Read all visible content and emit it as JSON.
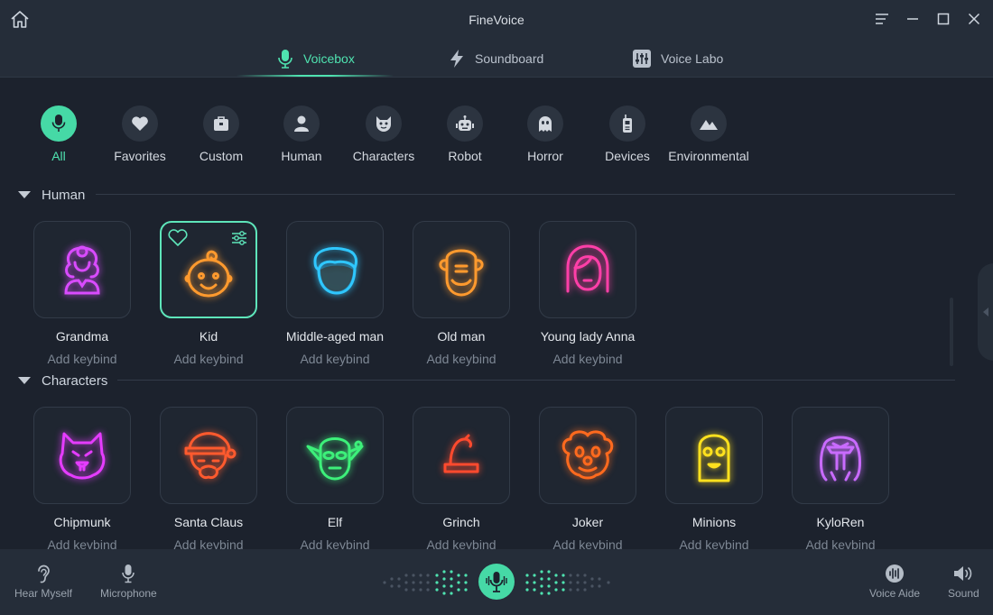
{
  "app": {
    "title": "FineVoice"
  },
  "tabs": [
    {
      "label": "Voicebox",
      "icon": "microphone-icon",
      "active": true
    },
    {
      "label": "Soundboard",
      "icon": "lightning-icon",
      "active": false
    },
    {
      "label": "Voice Labo",
      "icon": "sliders-icon",
      "active": false
    }
  ],
  "categories": [
    {
      "label": "All",
      "icon": "microphone-icon",
      "active": true
    },
    {
      "label": "Favorites",
      "icon": "heart-icon"
    },
    {
      "label": "Custom",
      "icon": "toolbox-icon"
    },
    {
      "label": "Human",
      "icon": "person-icon"
    },
    {
      "label": "Characters",
      "icon": "cat-face-icon"
    },
    {
      "label": "Robot",
      "icon": "robot-icon"
    },
    {
      "label": "Horror",
      "icon": "ghost-icon"
    },
    {
      "label": "Devices",
      "icon": "walkie-talkie-icon"
    },
    {
      "label": "Environmental",
      "icon": "mountain-icon"
    }
  ],
  "sections": [
    {
      "title": "Human",
      "voices": [
        {
          "name": "Grandma",
          "keybind": "Add keybind",
          "icon": "grandma-icon",
          "color": "#d94bff"
        },
        {
          "name": "Kid",
          "keybind": "Add keybind",
          "icon": "kid-icon",
          "color": "#ff9a2e",
          "selected": true
        },
        {
          "name": "Middle-aged man",
          "keybind": "Add keybind",
          "icon": "middle-aged-man-icon",
          "color": "#2fc7ff"
        },
        {
          "name": "Old man",
          "keybind": "Add keybind",
          "icon": "old-man-icon",
          "color": "#ff9a2e"
        },
        {
          "name": "Young lady Anna",
          "keybind": "Add keybind",
          "icon": "young-lady-icon",
          "color": "#ff3fa8"
        }
      ]
    },
    {
      "title": "Characters",
      "voices": [
        {
          "name": "Chipmunk",
          "keybind": "Add keybind",
          "icon": "chipmunk-icon",
          "color": "#e53cff"
        },
        {
          "name": "Santa Claus",
          "keybind": "Add keybind",
          "icon": "santa-claus-icon",
          "color": "#ff5a2e"
        },
        {
          "name": "Elf",
          "keybind": "Add keybind",
          "icon": "elf-icon",
          "color": "#3df07a"
        },
        {
          "name": "Grinch",
          "keybind": "Add keybind",
          "icon": "grinch-hat-icon",
          "color": "#ff4a2e"
        },
        {
          "name": "Joker",
          "keybind": "Add keybind",
          "icon": "joker-icon",
          "color": "#ff6a1e"
        },
        {
          "name": "Minions",
          "keybind": "Add keybind",
          "icon": "minion-icon",
          "color": "#ffe11e"
        },
        {
          "name": "KyloRen",
          "keybind": "Add keybind",
          "icon": "kylo-ren-icon",
          "color": "#c96bff"
        }
      ]
    }
  ],
  "bottom": {
    "hear_myself": "Hear Myself",
    "microphone": "Microphone",
    "voice_aide": "Voice Aide",
    "sound": "Sound"
  },
  "colors": {
    "accent": "#4fe3b0",
    "background": "#1c222d",
    "panel": "#252d39"
  }
}
